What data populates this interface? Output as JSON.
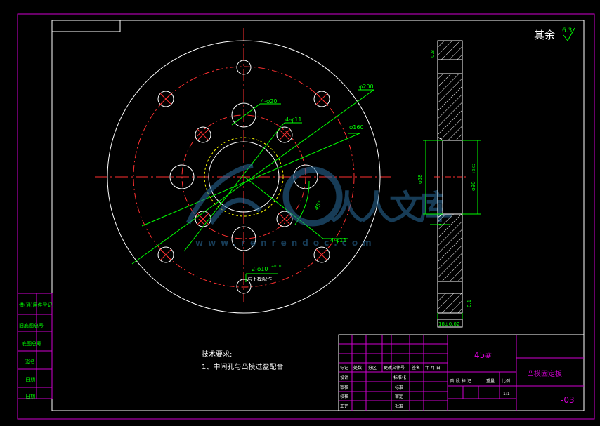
{
  "roughness": {
    "label": "其余",
    "value": "6.3"
  },
  "dims": {
    "phi200": "φ200",
    "phi160": "φ160",
    "holes_20": "4-φ20",
    "holes_11a": "4-φ11",
    "holes_11b": "4-φ11",
    "slot": "2-φ10",
    "slot_tol": "+0.01",
    "slot_note": "与下模配作",
    "angle": "45°",
    "phi58": "φ58",
    "phi90": "φ90",
    "phi90_tol": "+0.02",
    "depth5": "5",
    "side_top": "0.8",
    "side_bottom": "0.1",
    "thickness": "18±0.02"
  },
  "tech": {
    "heading": "技术要求:",
    "item1": "1、中间孔与凸模过盈配合"
  },
  "watermark": {
    "text": "www.renrendoc.com",
    "logo": "人人文库"
  },
  "title_block": {
    "material": "45#",
    "part_name": "凸模固定板",
    "drawing_no": "-03",
    "scale": "1:1",
    "row_labels": [
      "标记",
      "处数",
      "分区",
      "更改文件号",
      "签名",
      "年 月 日"
    ],
    "roles_left": [
      "设计",
      "校核",
      "审核",
      "工艺"
    ],
    "roles_mid": [
      "标准化",
      "标准",
      "审定",
      "批准"
    ],
    "stage_labels": [
      "阶 段 标 记",
      "重量",
      "比例"
    ]
  },
  "left_strip": [
    "借(通)用件登记",
    "旧底图总号",
    "底图总号",
    "签名",
    "日期",
    "日期"
  ]
}
